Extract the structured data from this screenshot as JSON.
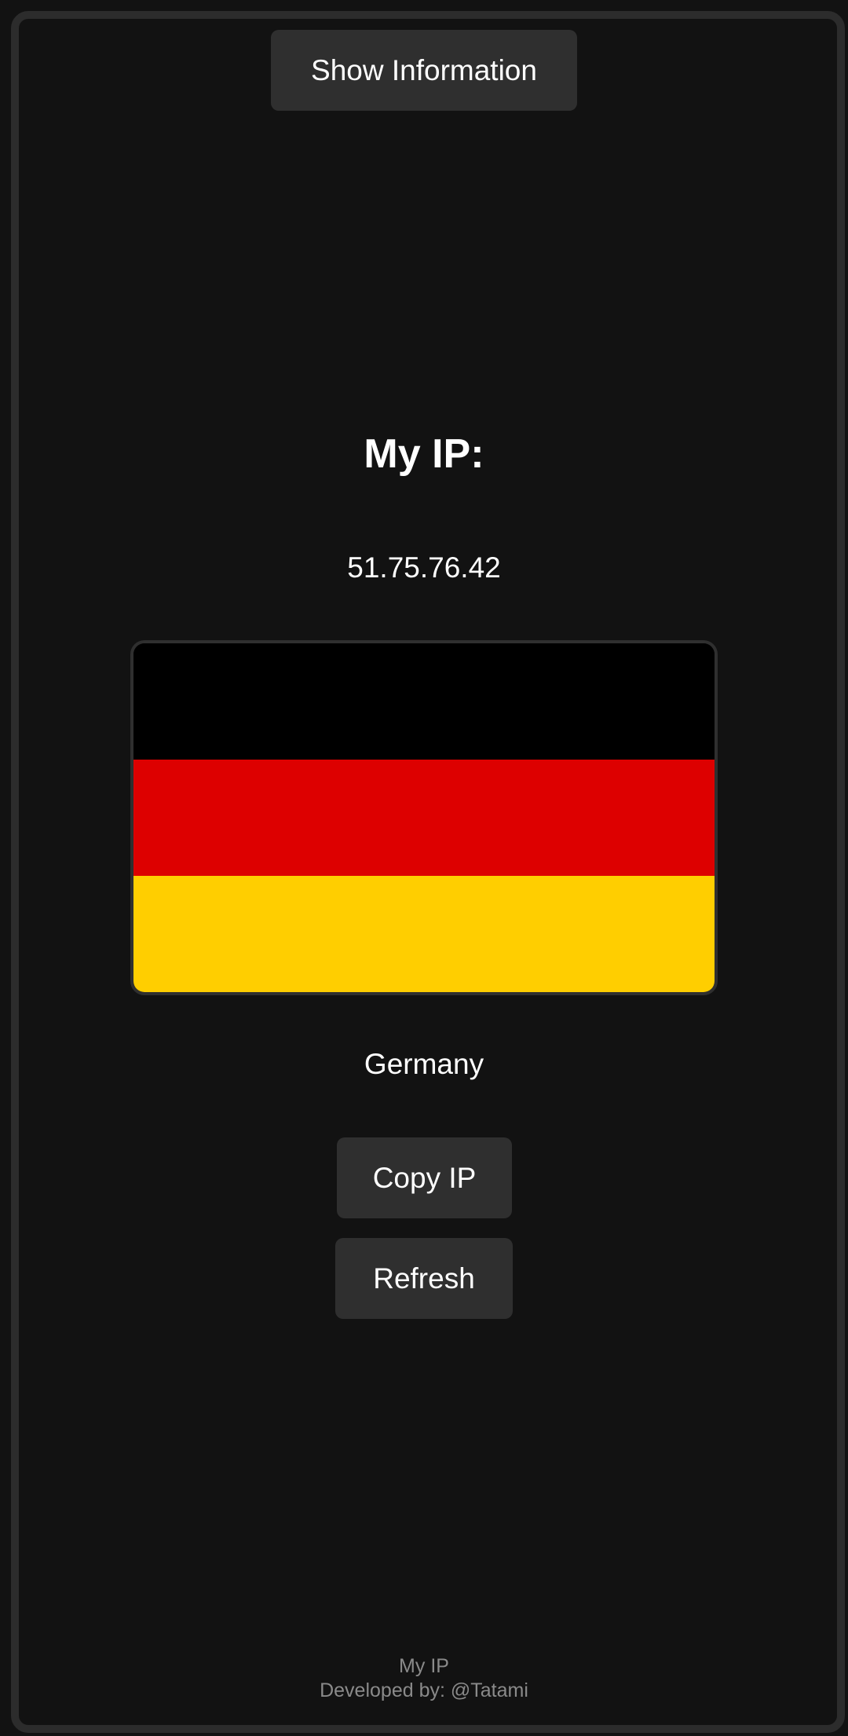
{
  "header": {
    "show_info_label": "Show Information"
  },
  "main": {
    "title": "My IP:",
    "ip_address": "51.75.76.42",
    "country": "Germany",
    "flag": {
      "country": "Germany",
      "stripes": [
        "#000000",
        "#dd0000",
        "#ffce00"
      ]
    },
    "copy_label": "Copy IP",
    "refresh_label": "Refresh"
  },
  "footer": {
    "app_name": "My IP",
    "developer": "Developed by: @Tatami"
  },
  "colors": {
    "background": "#121212",
    "frame": "#2c2c2c",
    "button": "#2f2f2f",
    "text": "#ffffff",
    "muted_text": "#8a8a8a"
  }
}
